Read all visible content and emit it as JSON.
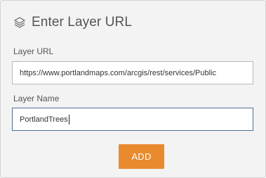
{
  "panel": {
    "title": "Enter Layer URL",
    "title_icon": "layers-icon"
  },
  "layer_url": {
    "label": "Layer URL",
    "value": "https://www.portlandmaps.com/arcgis/rest/services/Public"
  },
  "layer_name": {
    "label": "Layer Name",
    "value": "PortlandTrees"
  },
  "add_button": {
    "label": "ADD"
  },
  "colors": {
    "panel_bg": "#f3f3f3",
    "accent_button": "#e98a2f",
    "active_border": "#4f6e95",
    "text": "#555555"
  }
}
